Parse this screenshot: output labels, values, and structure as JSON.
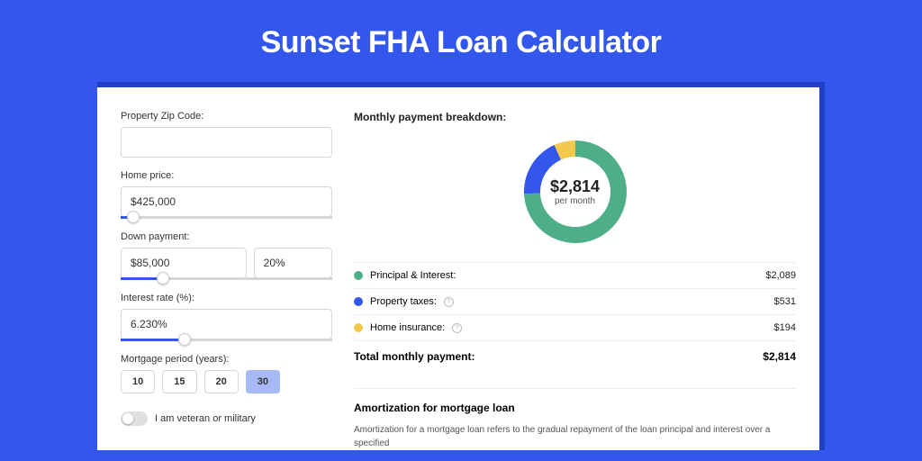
{
  "page": {
    "title": "Sunset FHA Loan Calculator"
  },
  "colors": {
    "green": "#4fae8a",
    "blue": "#3357ed",
    "yellow": "#f2c94c"
  },
  "form": {
    "zip": {
      "label": "Property Zip Code:",
      "value": ""
    },
    "home_price": {
      "label": "Home price:",
      "value": "$425,000",
      "slider_pct": 6
    },
    "down_payment": {
      "label": "Down payment:",
      "amount": "$85,000",
      "pct": "20%",
      "slider_pct": 20
    },
    "interest": {
      "label": "Interest rate (%):",
      "value": "6.230%",
      "slider_pct": 30
    },
    "period": {
      "label": "Mortgage period (years):",
      "options": [
        "10",
        "15",
        "20",
        "30"
      ],
      "active_index": 3
    },
    "veteran": {
      "label": "I am veteran or military",
      "on": false
    }
  },
  "breakdown": {
    "heading": "Monthly payment breakdown:",
    "center_value": "$2,814",
    "center_sub": "per month",
    "items": [
      {
        "label": "Principal & Interest:",
        "value": "$2,089",
        "color": "#4fae8a",
        "info": false
      },
      {
        "label": "Property taxes:",
        "value": "$531",
        "color": "#3357ed",
        "info": true
      },
      {
        "label": "Home insurance:",
        "value": "$194",
        "color": "#f2c94c",
        "info": true
      }
    ],
    "total_label": "Total monthly payment:",
    "total_value": "$2,814"
  },
  "chart_data": {
    "type": "pie",
    "title": "Monthly payment breakdown",
    "categories": [
      "Principal & Interest",
      "Property taxes",
      "Home insurance"
    ],
    "values": [
      2089,
      531,
      194
    ],
    "total": 2814,
    "unit": "$ per month"
  },
  "amort": {
    "heading": "Amortization for mortgage loan",
    "text": "Amortization for a mortgage loan refers to the gradual repayment of the loan principal and interest over a specified"
  }
}
